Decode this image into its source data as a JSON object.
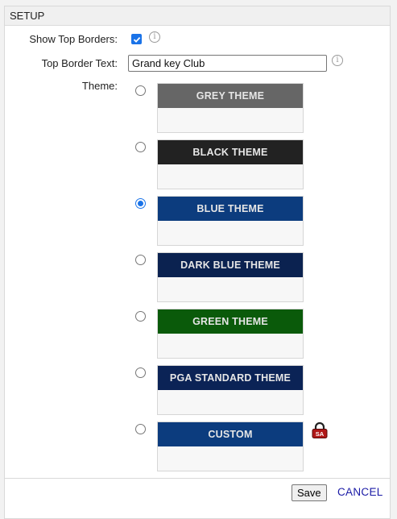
{
  "panel": {
    "title": "SETUP"
  },
  "form": {
    "show_top_borders_label": "Show Top Borders:",
    "show_top_borders_checked": true,
    "top_border_text_label": "Top Border Text:",
    "top_border_text_value": "Grand key Club",
    "theme_label": "Theme:",
    "info_glyph": "i"
  },
  "themes": [
    {
      "label": "GREY THEME",
      "color": "#666666",
      "selected": false
    },
    {
      "label": "BLACK THEME",
      "color": "#222222",
      "selected": false
    },
    {
      "label": "BLUE THEME",
      "color": "#0c3c7e",
      "selected": true
    },
    {
      "label": "DARK BLUE THEME",
      "color": "#0b2250",
      "selected": false
    },
    {
      "label": "GREEN THEME",
      "color": "#0a5a0a",
      "selected": false
    },
    {
      "label": "PGA STANDARD THEME",
      "color": "#0b2356",
      "selected": false
    },
    {
      "label": "CUSTOM",
      "color": "#0c3c7e",
      "selected": false,
      "locked": true
    }
  ],
  "lock_badge": {
    "icon": "lock-sa-icon",
    "text": "SA",
    "color": "#b01818"
  },
  "footer": {
    "save_label": "Save",
    "cancel_label": "CANCEL"
  }
}
